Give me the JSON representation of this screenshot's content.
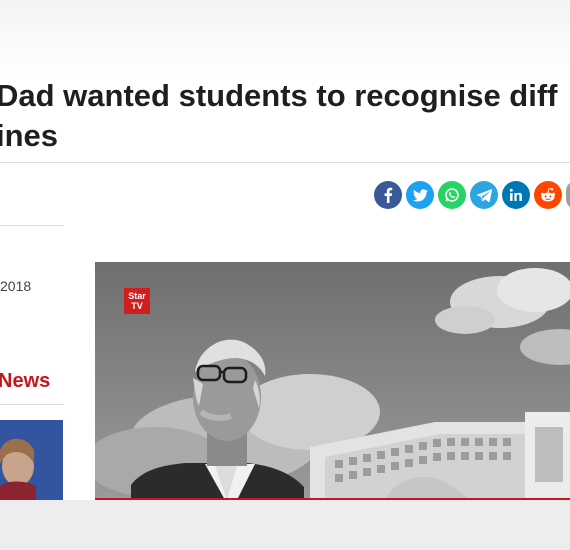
{
  "article": {
    "headline_line1": "Dad wanted students to recognise diff",
    "headline_line2": "ines"
  },
  "share": {
    "buttons": [
      {
        "name": "facebook-share-button",
        "icon": "facebook-icon",
        "color": "#3b5998"
      },
      {
        "name": "twitter-share-button",
        "icon": "twitter-icon",
        "color": "#1da1f2"
      },
      {
        "name": "whatsapp-share-button",
        "icon": "whatsapp-icon",
        "color": "#25d366"
      },
      {
        "name": "telegram-share-button",
        "icon": "telegram-icon",
        "color": "#2ca5e0"
      },
      {
        "name": "linkedin-share-button",
        "icon": "linkedin-icon",
        "color": "#0077b5"
      },
      {
        "name": "reddit-share-button",
        "icon": "reddit-icon",
        "color": "#ff4500"
      }
    ]
  },
  "meta": {
    "date_fragment": "2018"
  },
  "sidebar": {
    "section_title": "News"
  },
  "video": {
    "logo_text": "Star TV"
  },
  "colors": {
    "accent": "#c4161c"
  }
}
